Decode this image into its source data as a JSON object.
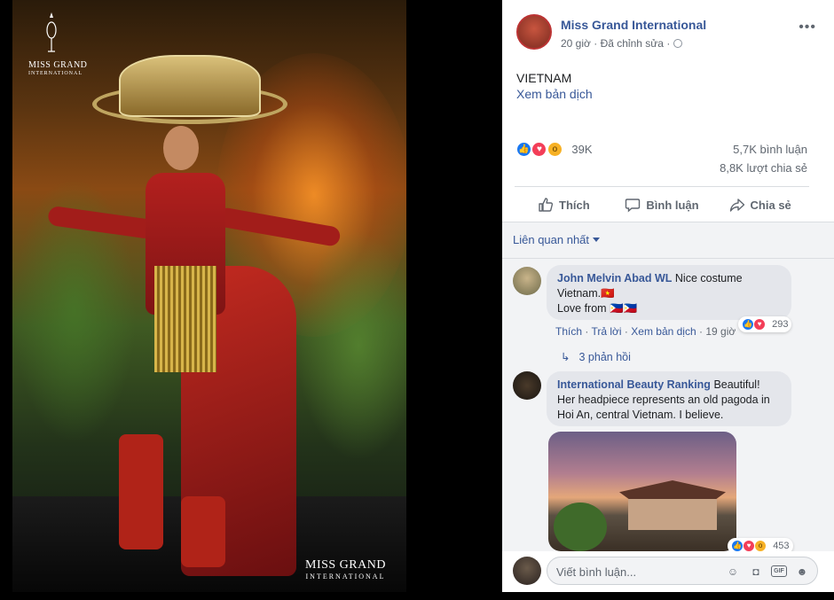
{
  "photo": {
    "logo_top_line1": "MISS GRAND",
    "logo_top_line2": "INTERNATIONAL",
    "logo_bottom_line1": "MISS GRAND",
    "logo_bottom_line2": "INTERNATIONAL"
  },
  "post": {
    "page_name": "Miss Grand International",
    "time": "20 giờ",
    "separator": "·",
    "edited": "Đã chỉnh sửa",
    "text": "VIETNAM",
    "see_translation": "Xem bản dịch",
    "reaction_count": "39K",
    "comments_count": "5,7K bình luận",
    "shares_count": "8,8K lượt chia sẻ",
    "reaction_icons": [
      "like-icon",
      "love-icon",
      "wow-icon"
    ]
  },
  "actions": {
    "like": "Thích",
    "comment": "Bình luận",
    "share": "Chia sẻ"
  },
  "comments": {
    "sort_label": "Liên quan nhất",
    "items": [
      {
        "author": "John Melvin Abad WL",
        "text_line1": "Nice costume",
        "text_line2": "Vietnam.🇻🇳",
        "text_line3": "Love from 🇵🇭🇵🇭",
        "reactions": "293",
        "like_link": "Thích",
        "reply_link": "Trả lời",
        "translate_link": "Xem bản dịch",
        "time": "19 giờ",
        "dot": "·",
        "replies": "3 phản hồi"
      },
      {
        "author": "International Beauty Ranking",
        "text_line1": "Beautiful!",
        "text_line2": "Her headpiece represents an old pagoda in",
        "text_line3": "Hoi An, central Vietnam. I believe.",
        "reactions": "453"
      }
    ]
  },
  "composer": {
    "placeholder": "Viết bình luận..."
  },
  "colors": {
    "link_blue": "#385898",
    "like_blue": "#1877f2",
    "love_red": "#f33e58",
    "wow_yellow": "#f7b125"
  }
}
